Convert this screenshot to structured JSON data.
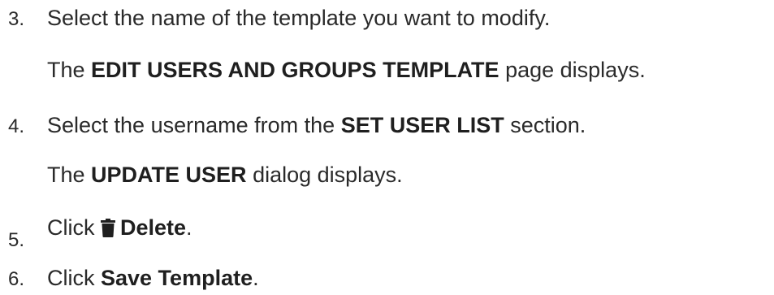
{
  "steps": [
    {
      "number": "3.",
      "text": "Select the name of the template you want to modify.",
      "result_pre": "The ",
      "result_bold": "EDIT USERS AND GROUPS TEMPLATE",
      "result_post": " page displays."
    },
    {
      "number": "4.",
      "text_pre": "Select the username from the ",
      "text_bold": "SET USER LIST",
      "text_post": " section.",
      "result_pre": "The ",
      "result_bold": "UPDATE USER",
      "result_post": " dialog displays."
    },
    {
      "number": "5.",
      "text_pre": "Click ",
      "icon": "trash-icon",
      "text_bold": "Delete",
      "text_post": "."
    },
    {
      "number": "6.",
      "text_pre": "Click ",
      "text_bold": "Save Template",
      "text_post": "."
    }
  ]
}
